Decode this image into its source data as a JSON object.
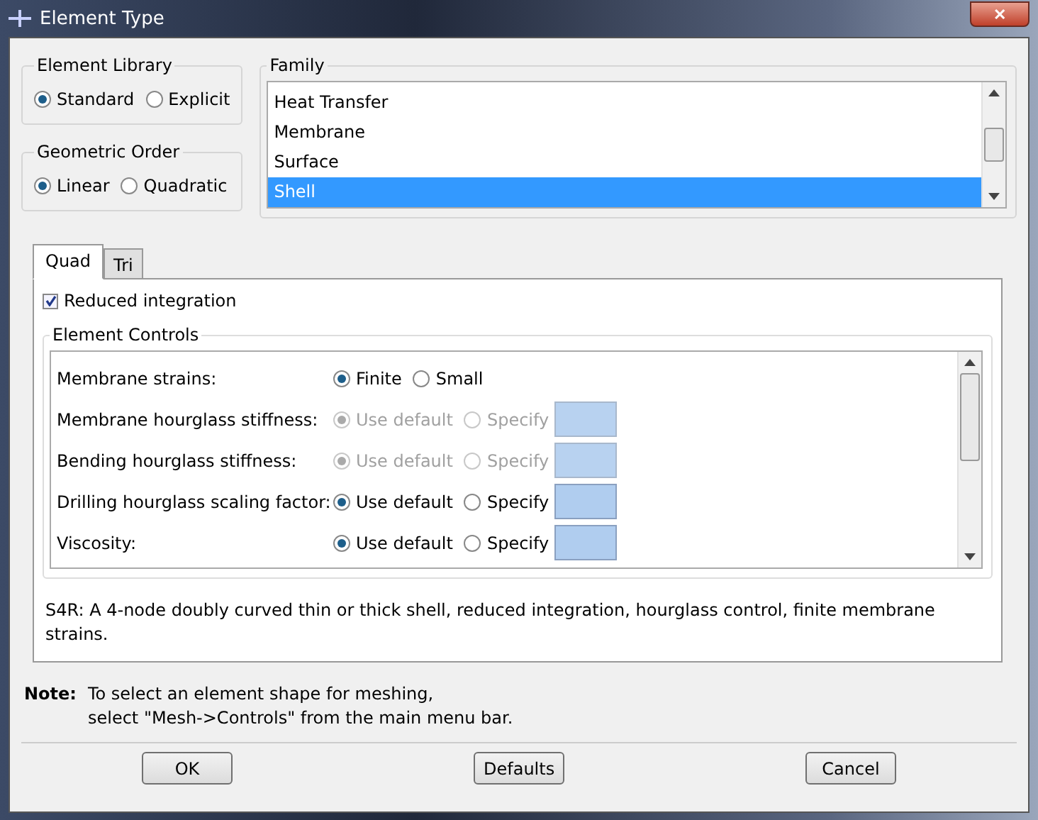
{
  "window": {
    "title": "Element Type",
    "close": "✕"
  },
  "element_library": {
    "title": "Element Library",
    "options": [
      {
        "label": "Standard",
        "selected": true
      },
      {
        "label": "Explicit",
        "selected": false
      }
    ]
  },
  "geometric_order": {
    "title": "Geometric Order",
    "options": [
      {
        "label": "Linear",
        "selected": true
      },
      {
        "label": "Quadratic",
        "selected": false
      }
    ]
  },
  "family": {
    "title": "Family",
    "items": [
      {
        "label": "Heat Transfer",
        "selected": false
      },
      {
        "label": "Membrane",
        "selected": false
      },
      {
        "label": "Surface",
        "selected": false
      },
      {
        "label": "Shell",
        "selected": true
      }
    ]
  },
  "tabs": [
    {
      "label": "Quad",
      "selected": true
    },
    {
      "label": "Tri",
      "selected": false
    }
  ],
  "reduced_integration": {
    "label": "Reduced integration",
    "checked": true
  },
  "element_controls": {
    "title": "Element Controls",
    "rows": [
      {
        "kind": "choice",
        "label": "Membrane strains:",
        "disabled": false,
        "options": [
          {
            "label": "Finite",
            "selected": true
          },
          {
            "label": "Small",
            "selected": false
          }
        ]
      },
      {
        "kind": "choice_field",
        "label": "Membrane hourglass stiffness:",
        "disabled": true,
        "options": [
          {
            "label": "Use default",
            "selected": true
          },
          {
            "label": "Specify",
            "selected": false
          }
        ]
      },
      {
        "kind": "choice_field",
        "label": "Bending hourglass stiffness:",
        "disabled": true,
        "options": [
          {
            "label": "Use default",
            "selected": true
          },
          {
            "label": "Specify",
            "selected": false
          }
        ]
      },
      {
        "kind": "choice_field",
        "label": "Drilling hourglass scaling factor:",
        "disabled": false,
        "options": [
          {
            "label": "Use default",
            "selected": true
          },
          {
            "label": "Specify",
            "selected": false
          }
        ]
      },
      {
        "kind": "choice_field",
        "label": "Viscosity:",
        "disabled": false,
        "options": [
          {
            "label": "Use default",
            "selected": true
          },
          {
            "label": "Specify",
            "selected": false
          }
        ]
      }
    ]
  },
  "description": "S4R:  A 4-node doubly curved thin or thick shell, reduced integration, hourglass control, finite membrane strains.",
  "note": {
    "label": "Note:",
    "lines": [
      "To select an element shape for meshing,",
      "select \"Mesh->Controls\" from the main menu bar."
    ]
  },
  "buttons": [
    "OK",
    "Defaults",
    "Cancel"
  ]
}
